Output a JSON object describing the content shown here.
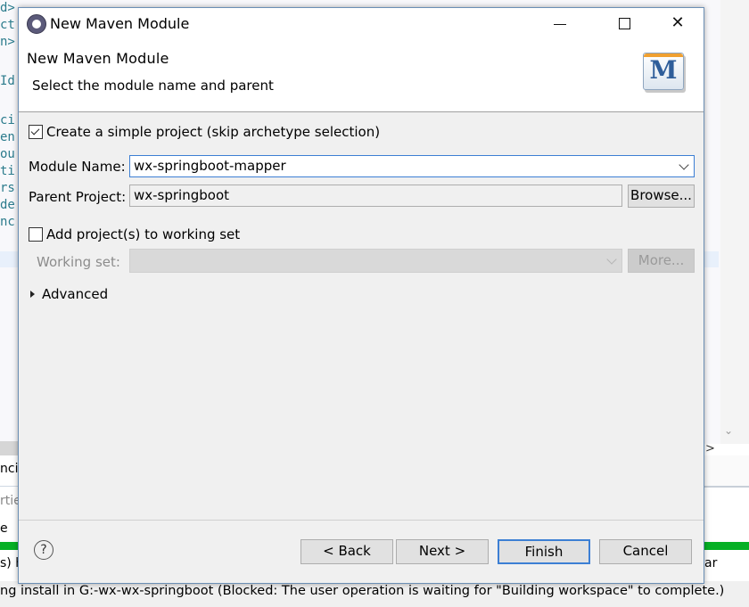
{
  "background": {
    "code_lines": [
      "d>",
      "ct",
      "n>",
      "Id",
      "ci",
      "en",
      "ou",
      "ti",
      "rs",
      "de",
      "nc"
    ],
    "panel_fragments": [
      "ncie",
      "rtie",
      "e",
      "s) h",
      "ar"
    ],
    "status_text": "ng install in G:-wx-wx-springboot (Blocked: The user operation is waiting for \"Building workspace\" to complete.)"
  },
  "dialog": {
    "window_title": "New Maven Module",
    "header_title": "New Maven Module",
    "header_subtitle": "Select the module name and parent",
    "logo_letter": "M",
    "simple_project": {
      "label": "Create a simple project (skip archetype selection)",
      "checked": true
    },
    "module_name": {
      "label": "Module Name:",
      "value": "wx-springboot-mapper"
    },
    "parent_project": {
      "label": "Parent Project:",
      "value": "wx-springboot",
      "browse_label": "Browse..."
    },
    "working_set_checkbox": {
      "label": "Add project(s) to working set",
      "checked": false
    },
    "working_set": {
      "label": "Working set:",
      "value": "",
      "more_label": "More..."
    },
    "advanced_label": "Advanced",
    "help_icon": "?",
    "buttons": {
      "back": "< Back",
      "next": "Next >",
      "finish": "Finish",
      "cancel": "Cancel"
    }
  },
  "colors": {
    "accent": "#3c7fd4",
    "progress": "#06b025"
  }
}
